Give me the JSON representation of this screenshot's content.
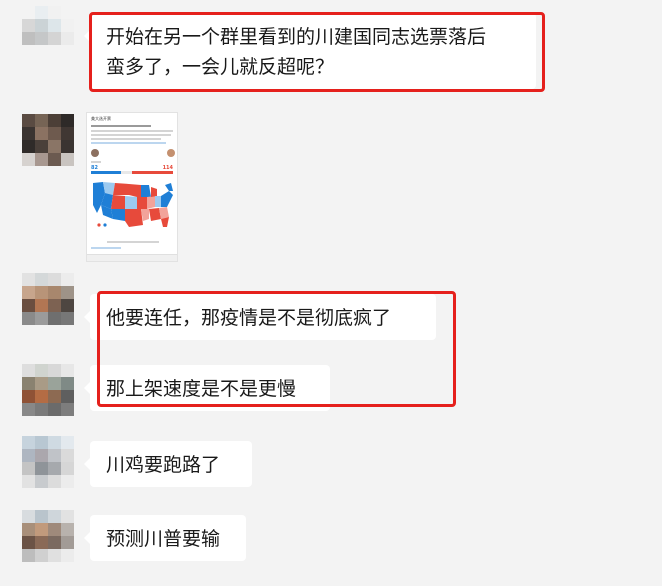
{
  "messages": [
    {
      "id": "m1",
      "text_lines": [
        "开始在另一个群里看到的川建国同志选票落后",
        "蛮多了，一会儿就反超呢？"
      ]
    },
    {
      "id": "m2",
      "type": "image",
      "title": "美大选开票",
      "left_count": "82",
      "right_count": "114"
    },
    {
      "id": "m3",
      "text": "他要连任，那疫情是不是彻底疯了"
    },
    {
      "id": "m4",
      "text": "那上架速度是不是更慢"
    },
    {
      "id": "m5",
      "text": "川鸡要跑路了"
    },
    {
      "id": "m6",
      "text": "预测川普要输"
    }
  ],
  "colors": {
    "highlight": "#e5201c",
    "bubble": "#ffffff",
    "background": "#f3f3f3",
    "map_blue": "#1f7fd6",
    "map_red": "#e74a3b"
  }
}
